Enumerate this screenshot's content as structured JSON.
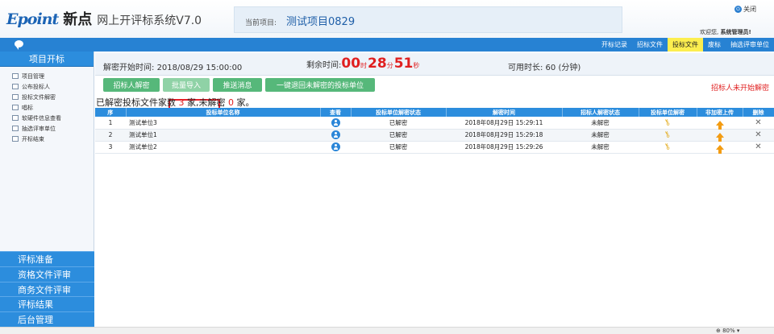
{
  "header": {
    "brand": "Epoint",
    "brand_cn": "新点",
    "system_title": "网上开评标系统V7.0",
    "project_label": "当前项目:",
    "project_name": "测试项目0829",
    "close_label": "关闭",
    "welcome_prefix": "欢迎您,",
    "username": "系统管理员!"
  },
  "nav": {
    "links": [
      "开标记录",
      "招标文件",
      "投标文件",
      "废标",
      "抽选评审单位"
    ],
    "active": "投标文件"
  },
  "sidebar": {
    "title": "项目开标",
    "items": [
      "项目管理",
      "公布投标人",
      "投标文件解密",
      "唱标",
      "软硬件信息查看",
      "抽选评审单位",
      "开标结束"
    ],
    "sections": [
      "评标准备",
      "资格文件评审",
      "商务文件评审",
      "评标结果",
      "后台管理"
    ]
  },
  "info": {
    "start_label": "解密开始时间:",
    "start_time": "2018/08/29 15:00:00",
    "remaining_label": "剩余时间:",
    "remaining_hours": "00",
    "hours_unit": "时",
    "remaining_minutes": "28",
    "minutes_unit": "分",
    "remaining_seconds": "51",
    "seconds_unit": "秒",
    "duration_text": "可用时长: 60 (分钟)"
  },
  "toolbar": {
    "decrypt_label": "招标人解密",
    "import_label": "批量导入",
    "push_label": "推送消息",
    "rollback_label": "一键退回未解密的投标单位",
    "status_text": "招标人未开始解密"
  },
  "summary": {
    "prefix": "已解密投标文件家数",
    "decrypted": "3",
    "mid": "家,未解密",
    "undecrypted": "0",
    "suffix": "家。"
  },
  "table": {
    "headers": [
      "序",
      "投标单位名称",
      "查看",
      "投标单位解密状态",
      "解密时间",
      "招标人解密状态",
      "投标单位解密",
      "非加密上传",
      "删除"
    ],
    "rows": [
      {
        "no": "1",
        "name": "测试单位3",
        "unit_status": "已解密",
        "time": "2018年08月29日 15:29:11",
        "owner_status": "未解密"
      },
      {
        "no": "2",
        "name": "测试单位1",
        "unit_status": "已解密",
        "time": "2018年08月29日 15:29:18",
        "owner_status": "未解密"
      },
      {
        "no": "3",
        "name": "测试单位2",
        "unit_status": "已解密",
        "time": "2018年08月29日 15:29:26",
        "owner_status": "未解密"
      }
    ]
  },
  "statusbar": {
    "zoom": "80%"
  },
  "colors": {
    "primary": "#2c8ddd",
    "button_green": "#56b87a",
    "highlight_red": "#e8202a",
    "nav_active": "#fcee4f"
  }
}
